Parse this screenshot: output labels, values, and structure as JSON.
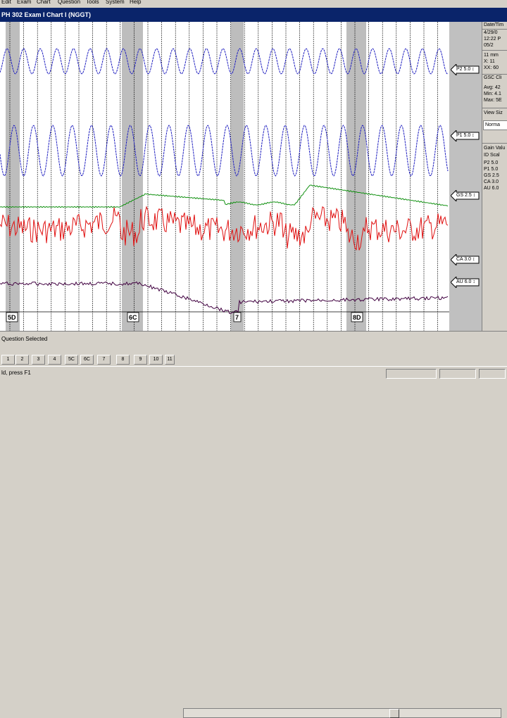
{
  "menubar": [
    "Edit",
    "Exam",
    "Chart",
    "Question",
    "Tools",
    "System",
    "Help"
  ],
  "title": "PH 302   Exam I   Chart I (NGGT)",
  "chart": {
    "question_labels": [
      "5D",
      "6C",
      "7",
      "8D"
    ],
    "colors": {
      "pneumo": "#1f1fc0",
      "gsr": "#109010",
      "cardio": "#e01010",
      "activity": "#400040",
      "question_band": "#bdbdbd"
    }
  },
  "channel_markers": [
    {
      "label": "P2  5.0 ↕",
      "icon": "left-arrow-icon"
    },
    {
      "label": "P1  5.0 ↕",
      "icon": "left-arrow-icon"
    },
    {
      "label": "GS  2.5 ↕",
      "icon": "left-arrow-icon"
    },
    {
      "label": "CA  3.0 ↕",
      "icon": "left-arrow-icon"
    },
    {
      "label": "AU  6.0 ↕",
      "icon": "left-arrow-icon"
    }
  ],
  "side_panel": {
    "date_label": "Date/Tim",
    "date_lines": [
      "4/29/0",
      "12:22 P",
      "05/2"
    ],
    "scale_lines": [
      "11 mm",
      "X:  11",
      "XX: 60"
    ],
    "gsc_label": "GSC Cli",
    "gsc_lines": [
      "Avg: 42",
      "Min: 4.1",
      "Max: 5E"
    ],
    "view_label": "View Siz",
    "view_value": "Norma",
    "gain_label": "Gain Valu",
    "gain_sub": "ID  Scal",
    "gain_lines": [
      "P2  5.0",
      "P1  5.0",
      "GS  2.5",
      "CA  3.0",
      "AU  6.0"
    ]
  },
  "question_status": "Question Selected",
  "nav_buttons": [
    "1",
    "2",
    "3",
    "4",
    "5C",
    "6C",
    "7",
    "8",
    "9",
    "10",
    "11"
  ],
  "status_message": "ld, press F1"
}
